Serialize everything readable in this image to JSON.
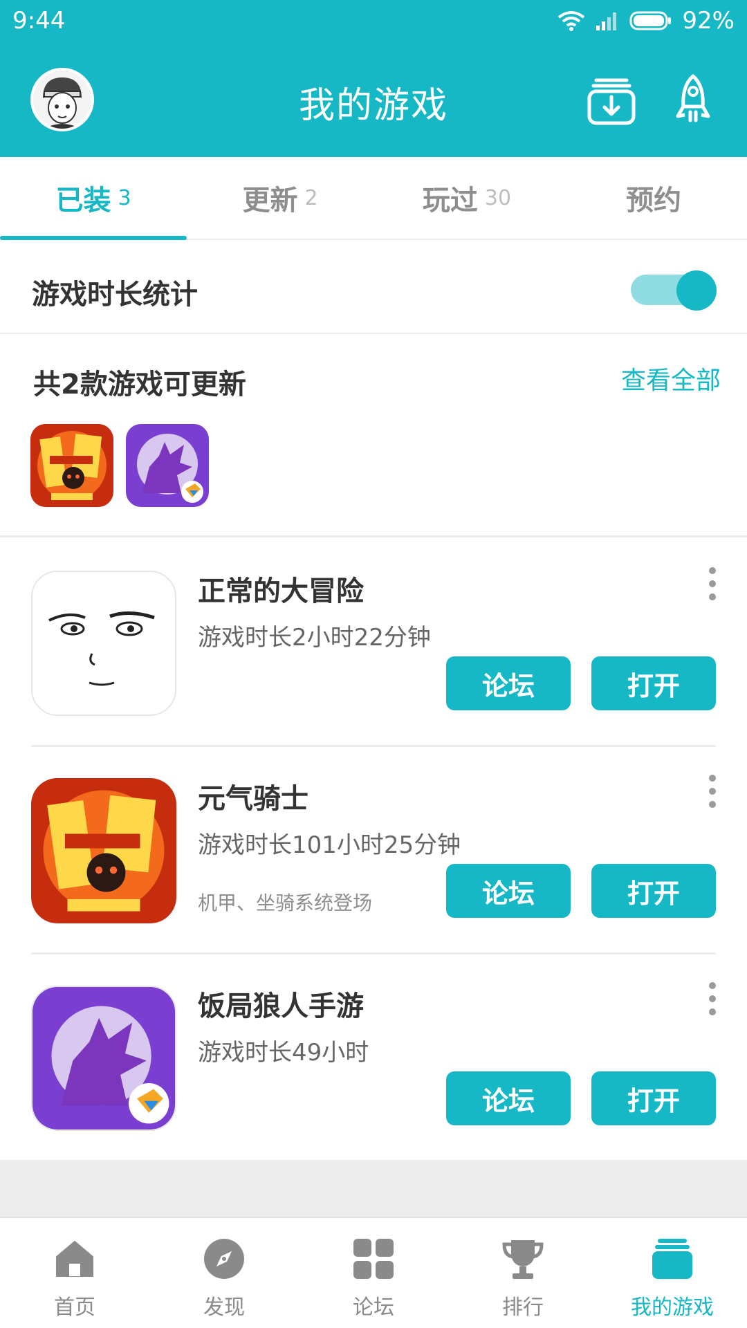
{
  "status_bar": {
    "time": "9:44",
    "battery": "92%"
  },
  "header": {
    "title": "我的游戏",
    "avatar_icon": "avatar",
    "download_icon": "download-box-icon",
    "rocket_icon": "rocket-icon"
  },
  "tabs": [
    {
      "label": "已装",
      "count": "3",
      "active": true
    },
    {
      "label": "更新",
      "count": "2",
      "active": false
    },
    {
      "label": "玩过",
      "count": "30",
      "active": false
    },
    {
      "label": "预约",
      "count": "",
      "active": false
    }
  ],
  "stats_toggle": {
    "label": "游戏时长统计",
    "on": true
  },
  "updates": {
    "title": "共2款游戏可更新",
    "view_all": "查看全部"
  },
  "games": [
    {
      "name": "正常的大冒险",
      "playtime": "游戏时长2小时22分钟",
      "note": "",
      "forum_label": "论坛",
      "open_label": "打开"
    },
    {
      "name": "元气骑士",
      "playtime": "游戏时长101小时25分钟",
      "note": "机甲、坐骑系统登场",
      "forum_label": "论坛",
      "open_label": "打开"
    },
    {
      "name": "饭局狼人手游",
      "playtime": "游戏时长49小时",
      "note": "",
      "forum_label": "论坛",
      "open_label": "打开"
    }
  ],
  "bottom_nav": [
    {
      "label": "首页",
      "icon": "home-icon",
      "active": false
    },
    {
      "label": "发现",
      "icon": "compass-icon",
      "active": false
    },
    {
      "label": "论坛",
      "icon": "grid-icon",
      "active": false
    },
    {
      "label": "排行",
      "icon": "trophy-icon",
      "active": false
    },
    {
      "label": "我的游戏",
      "icon": "my-games-icon",
      "active": true
    }
  ],
  "colors": {
    "accent": "#17b8c6",
    "text_dark": "#333333",
    "text_gray": "#8e8e8e"
  }
}
